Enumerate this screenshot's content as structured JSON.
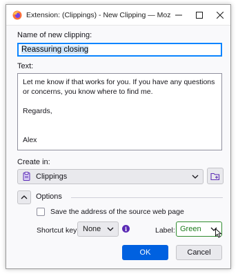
{
  "window": {
    "title": "Extension: (Clippings) - New Clipping — Mozil...",
    "controls": {
      "minimize": "minimize-icon",
      "maximize": "maximize-icon",
      "close": "close-icon"
    }
  },
  "form": {
    "name_label": "Name of new clipping:",
    "name_value": "Reassuring closing",
    "text_label": "Text:",
    "text_value": "Let me know if that works for you. If you have any questions or concerns, you know where to find me.\n\nRegards,\n\n\nAlex",
    "create_in_label": "Create in:",
    "folder_value": "Clippings"
  },
  "options": {
    "heading": "Options",
    "save_source_label": "Save the address of the source web page",
    "save_source_checked": false,
    "shortcut_label": "Shortcut key:",
    "shortcut_value": "None",
    "label_label": "Label:",
    "label_value": "Green"
  },
  "buttons": {
    "ok": "OK",
    "cancel": "Cancel"
  },
  "colors": {
    "accent": "#0061e0",
    "focus": "#0a84ff",
    "label_green": "#1a7a1a",
    "info": "#5b2bb5"
  }
}
